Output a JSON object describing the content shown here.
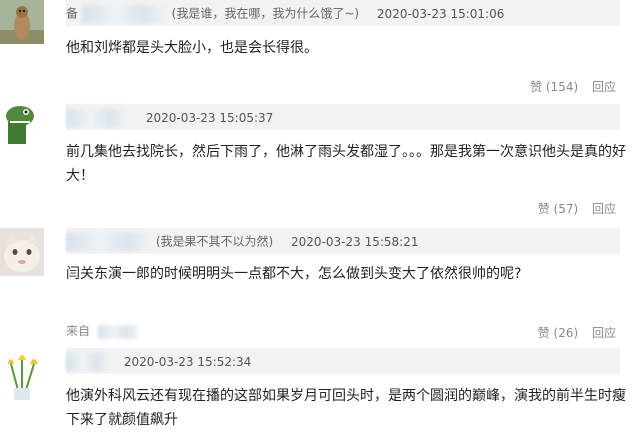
{
  "comments": [
    {
      "nick_visible": "备",
      "signature": "(我是谁，我在哪，我为什么饿了~)",
      "time": "2020-03-23 15:01:06",
      "text": "他和刘烨都是头大脸小，也是会长得很。",
      "like_label": "赞 (154)",
      "reply_label": "回应"
    },
    {
      "nick_visible": "",
      "signature": "",
      "time": "2020-03-23 15:05:37",
      "text": "前几集他去找院长，然后下雨了，他淋了雨头发都湿了。。。那是我第一次意识他头是真的好大！",
      "like_label": "赞 (57)",
      "reply_label": "回应"
    },
    {
      "nick_visible": "",
      "signature": "(我是果不其不以为然)",
      "time": "2020-03-23 15:58:21",
      "text": "闫关东演一郎的时候明明头一点都不大，怎么做到头变大了依然很帅的呢?",
      "from_label": "来自",
      "like_label": "赞 (26)",
      "reply_label": "回应"
    },
    {
      "nick_visible": "",
      "signature": "",
      "time": "2020-03-23 15:52:34",
      "text": "他演外科风云还有现在播的这部如果岁月可回头时，是两个圆润的巅峰，演我的前半生时瘦下来了就颜值飙升"
    }
  ],
  "icons": {
    "avatar1": "meerkat-avatar",
    "avatar2": "green-dinosaur-avatar",
    "avatar3": "cat-avatar",
    "avatar4": "tulips-avatar"
  }
}
